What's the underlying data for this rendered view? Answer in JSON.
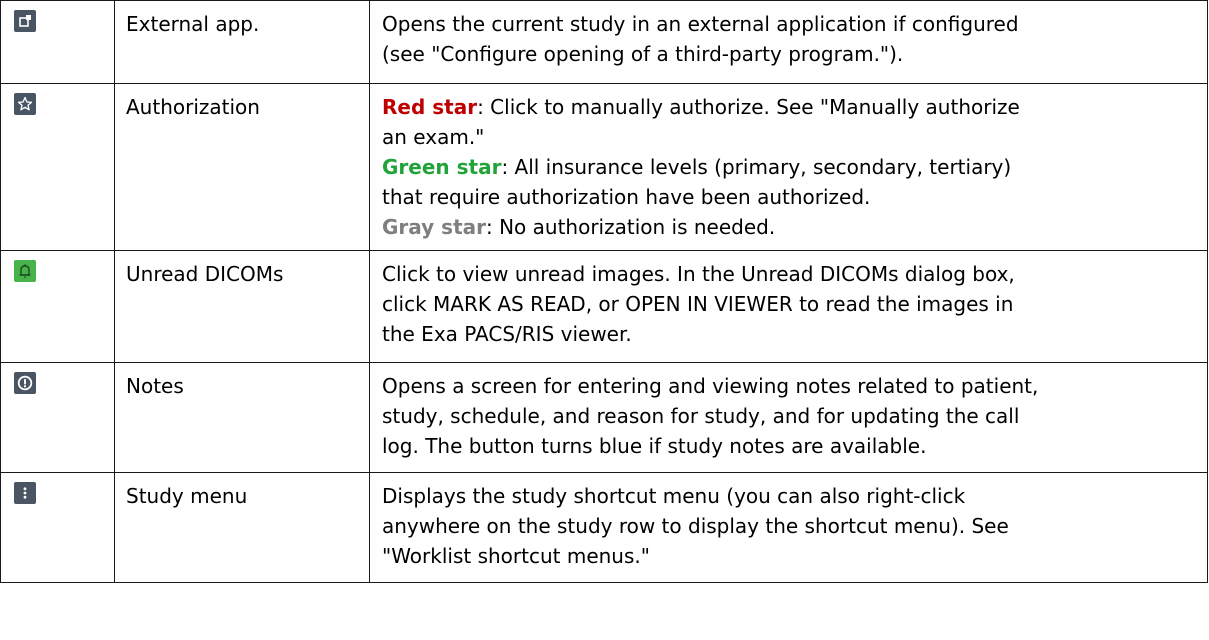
{
  "colors": {
    "icon_bg_dark": "#4a5563",
    "icon_bg_green": "#48b34a",
    "red_star": "#c00000",
    "green_star": "#22a33a",
    "gray_star": "#7f7f7f",
    "border": "#1a1a1a"
  },
  "rows": [
    {
      "icon": "external-app-icon",
      "name": "External app.",
      "lines": [
        "Opens the current study in an external application if configured",
        "(see \"Configure opening of a third-party program.\")."
      ]
    },
    {
      "icon": "star-icon",
      "name": "Authorization",
      "red": {
        "label": "Red star",
        "text": ": Click to manually authorize. See \"Manually authorize"
      },
      "red_cont": "an exam.\"",
      "green": {
        "label": "Green star",
        "text": ": All insurance levels (primary, secondary, tertiary)"
      },
      "green_cont": "that require authorization have been authorized.",
      "gray": {
        "label": "Gray star",
        "text": ": No authorization is needed."
      }
    },
    {
      "icon": "bell-icon",
      "name": "Unread DICOMs",
      "lines": [
        "Click to view unread images. In the Unread DICOMs dialog box,",
        "click MARK AS READ, or OPEN IN VIEWER to read the images in",
        "the Exa PACS/RIS viewer."
      ]
    },
    {
      "icon": "notes-info-icon",
      "name": "Notes",
      "lines": [
        "Opens a screen for entering and viewing notes related to patient,",
        "study, schedule, and reason for study, and for updating the call",
        "log. The button turns blue if study notes are available."
      ]
    },
    {
      "icon": "kebab-menu-icon",
      "name": "Study menu",
      "lines": [
        "Displays the study shortcut menu (you can also right-click",
        "anywhere on the study row to display the shortcut menu). See",
        "\"Worklist shortcut menus.\""
      ]
    }
  ]
}
